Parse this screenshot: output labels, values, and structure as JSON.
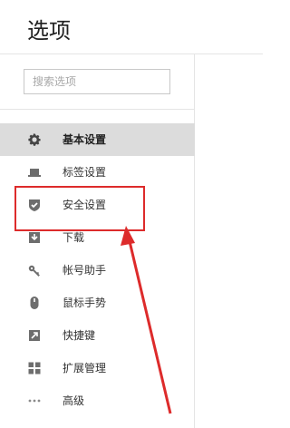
{
  "header": {
    "title": "选项"
  },
  "search": {
    "placeholder": "搜索选项"
  },
  "nav": {
    "items": [
      {
        "label": "基本设置",
        "icon": "gear-icon",
        "active": true
      },
      {
        "label": "标签设置",
        "icon": "laptop-icon"
      },
      {
        "label": "安全设置",
        "icon": "shield-check-icon"
      },
      {
        "label": "下载",
        "icon": "download-icon"
      },
      {
        "label": "帐号助手",
        "icon": "key-icon"
      },
      {
        "label": "鼠标手势",
        "icon": "mouse-icon"
      },
      {
        "label": "快捷键",
        "icon": "shortcut-arrow-icon"
      },
      {
        "label": "扩展管理",
        "icon": "extensions-grid-icon"
      },
      {
        "label": "高级",
        "icon": "more-dots-icon"
      }
    ]
  },
  "colors": {
    "accent": "#dd2b2b",
    "active_bg": "#dcdcdc",
    "icon": "#6d6d6d"
  }
}
